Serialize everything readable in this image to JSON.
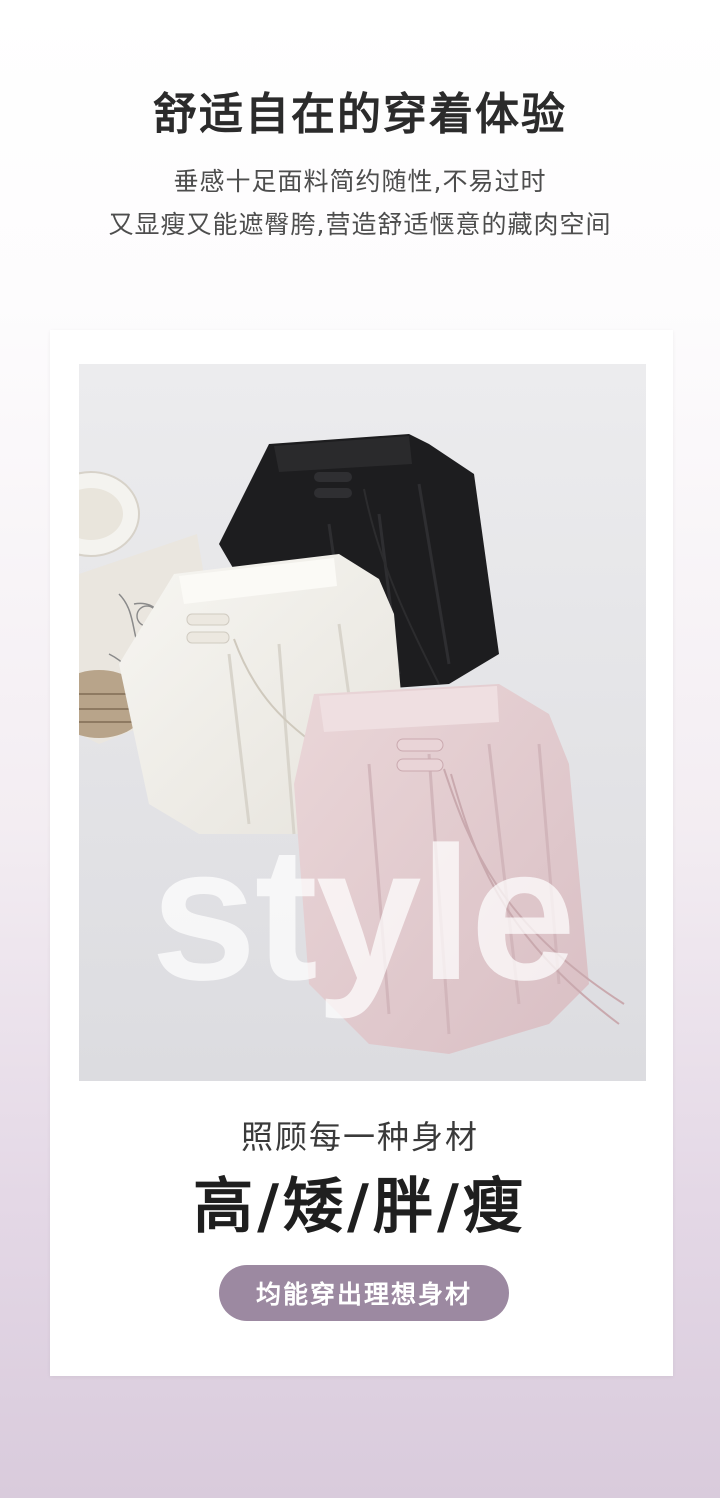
{
  "header": {
    "title": "舒适自在的穿着体验",
    "subtitle_line1": "垂感十足面料简约随性,不易过时",
    "subtitle_line2": "又显瘦又能遮臀胯,营造舒适惬意的藏肉空间"
  },
  "photo": {
    "watermark_text": "style"
  },
  "footer": {
    "caption": "照顾每一种身材",
    "body_types": "高/矮/胖/瘦",
    "badge": "均能穿出理想身材"
  },
  "colors": {
    "badge_bg": "#9c89a1",
    "pants_black": "#1d1d1f",
    "pants_white": "#f3f1ec",
    "pants_pink": "#e5cfd2"
  }
}
